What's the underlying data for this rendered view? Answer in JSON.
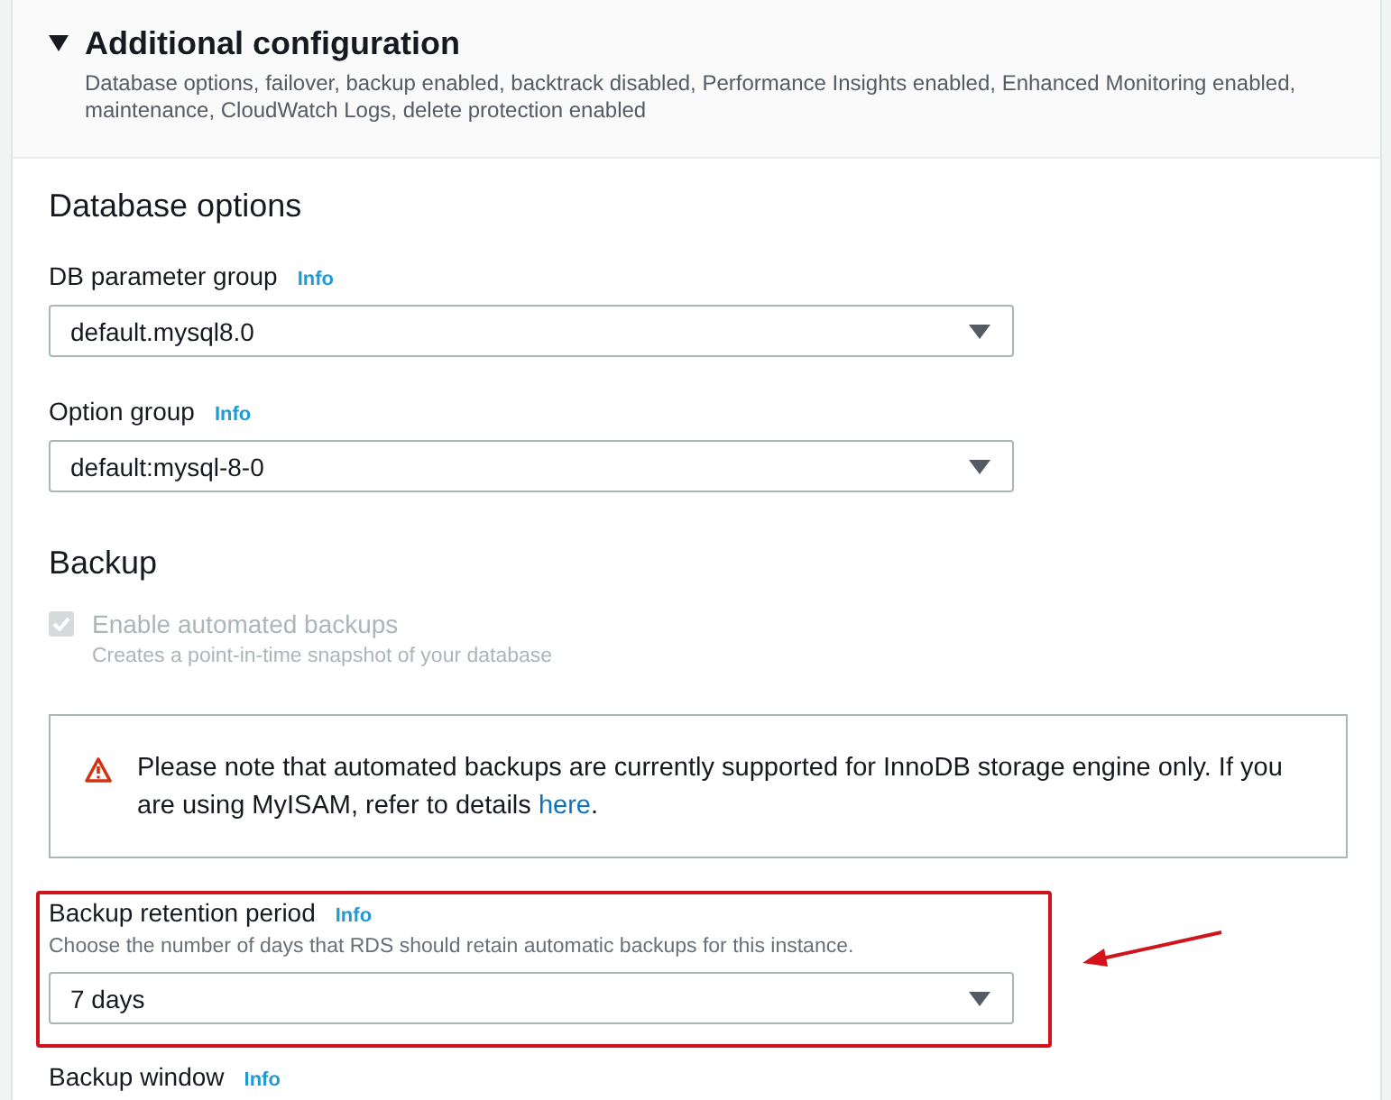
{
  "section": {
    "title": "Additional configuration",
    "expanded": true,
    "description": "Database options, failover, backup enabled, backtrack disabled, Performance Insights enabled, Enhanced Monitoring enabled, maintenance, CloudWatch Logs, delete protection enabled"
  },
  "groups": [
    {
      "heading": "Database options",
      "fields": [
        {
          "kind": "select",
          "label": "DB parameter group",
          "info": "Info",
          "value": "default.mysql8.0",
          "highlighted": false
        },
        {
          "kind": "select",
          "label": "Option group",
          "info": "Info",
          "value": "default:mysql-8-0",
          "highlighted": false
        }
      ]
    },
    {
      "heading": "Backup",
      "fields": [
        {
          "kind": "checkbox",
          "label": "Enable automated backups",
          "description": "Creates a point-in-time snapshot of your database",
          "checked": true,
          "disabled": true
        },
        {
          "kind": "alert",
          "text": "Please note that automated backups are currently supported for InnoDB storage engine only. If you are using MyISAM, refer to details",
          "link": "here",
          "text_end": "."
        },
        {
          "kind": "select",
          "label": "Backup retention period",
          "info": "Info",
          "description": "Choose the number of days that RDS should retain automatic backups for this instance.",
          "value": "7 days",
          "highlighted": true
        },
        {
          "kind": "label",
          "label": "Backup window",
          "info": "Info"
        }
      ]
    }
  ]
}
